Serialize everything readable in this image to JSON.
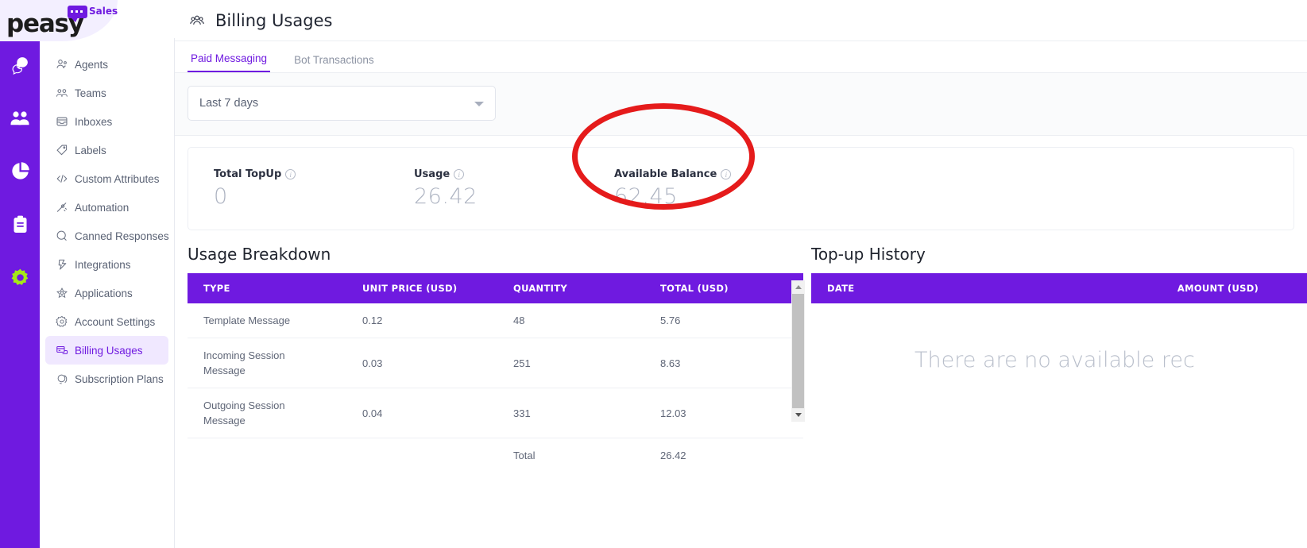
{
  "brand": {
    "name": "peasy",
    "suffix": "Sales"
  },
  "rail": {
    "items": [
      {
        "name": "conversations",
        "icon": "chat-bubbles-icon",
        "active": false
      },
      {
        "name": "contacts",
        "icon": "people-icon",
        "active": false
      },
      {
        "name": "reports",
        "icon": "pie-chart-icon",
        "active": false
      },
      {
        "name": "campaigns",
        "icon": "clipboard-icon",
        "active": false
      },
      {
        "name": "settings",
        "icon": "gear-icon",
        "active": true
      }
    ],
    "active_color": "#a5e817",
    "background": "#6f1ae0"
  },
  "sidebar": {
    "items": [
      {
        "label": "Agents",
        "icon": "agents-icon",
        "active": false
      },
      {
        "label": "Teams",
        "icon": "teams-icon",
        "active": false
      },
      {
        "label": "Inboxes",
        "icon": "inbox-icon",
        "active": false
      },
      {
        "label": "Labels",
        "icon": "label-tag-icon",
        "active": false
      },
      {
        "label": "Custom Attributes",
        "icon": "code-brackets-icon",
        "active": false
      },
      {
        "label": "Automation",
        "icon": "automation-icon",
        "active": false
      },
      {
        "label": "Canned Responses",
        "icon": "canned-response-icon",
        "active": false
      },
      {
        "label": "Integrations",
        "icon": "integrations-icon",
        "active": false
      },
      {
        "label": "Applications",
        "icon": "applications-icon",
        "active": false
      },
      {
        "label": "Account Settings",
        "icon": "gear-icon",
        "active": false
      },
      {
        "label": "Billing Usages",
        "icon": "billing-icon",
        "active": true
      },
      {
        "label": "Subscription Plans",
        "icon": "subscription-icon",
        "active": false
      }
    ],
    "active_bg": "#f0e8ff",
    "active_fg": "#6f1ae0"
  },
  "header": {
    "title": "Billing Usages",
    "icon": "billing-group-icon"
  },
  "tabs": [
    {
      "label": "Paid Messaging",
      "active": true
    },
    {
      "label": "Bot Transactions",
      "active": false
    }
  ],
  "filter": {
    "date_range_value": "Last 7 days",
    "caret_icon": "chevron-down-icon"
  },
  "stats": [
    {
      "label": "Total TopUp",
      "value": "0",
      "info_icon": "info-circle-icon"
    },
    {
      "label": "Usage",
      "value": "26.42",
      "info_icon": "info-circle-icon"
    },
    {
      "label": "Available Balance",
      "value": "62.45",
      "info_icon": "info-circle-icon"
    }
  ],
  "annotation": {
    "shape": "ellipse",
    "color": "#e51b1b",
    "target": "Available Balance"
  },
  "usage_breakdown": {
    "title": "Usage Breakdown",
    "columns": [
      "TYPE",
      "UNIT PRICE (USD)",
      "QUANTITY",
      "TOTAL (USD)"
    ],
    "rows": [
      {
        "type": "Template Message",
        "unit_price": "0.12",
        "quantity": "48",
        "total": "5.76"
      },
      {
        "type": "Incoming Session Message",
        "unit_price": "0.03",
        "quantity": "251",
        "total": "8.63"
      },
      {
        "type": "Outgoing Session Message",
        "unit_price": "0.04",
        "quantity": "331",
        "total": "12.03"
      }
    ],
    "total_row": {
      "type": "",
      "unit_price": "",
      "quantity": "Total",
      "total": "26.42"
    },
    "header_bg": "#6f1ae0"
  },
  "topup_history": {
    "title": "Top-up History",
    "columns": [
      "DATE",
      "AMOUNT (USD)"
    ],
    "empty_message": "There are no available rec",
    "header_bg": "#6f1ae0"
  },
  "scrollbar": {
    "name": "usage-table-scrollbar",
    "up_icon": "caret-up-icon",
    "down_icon": "caret-down-icon"
  }
}
